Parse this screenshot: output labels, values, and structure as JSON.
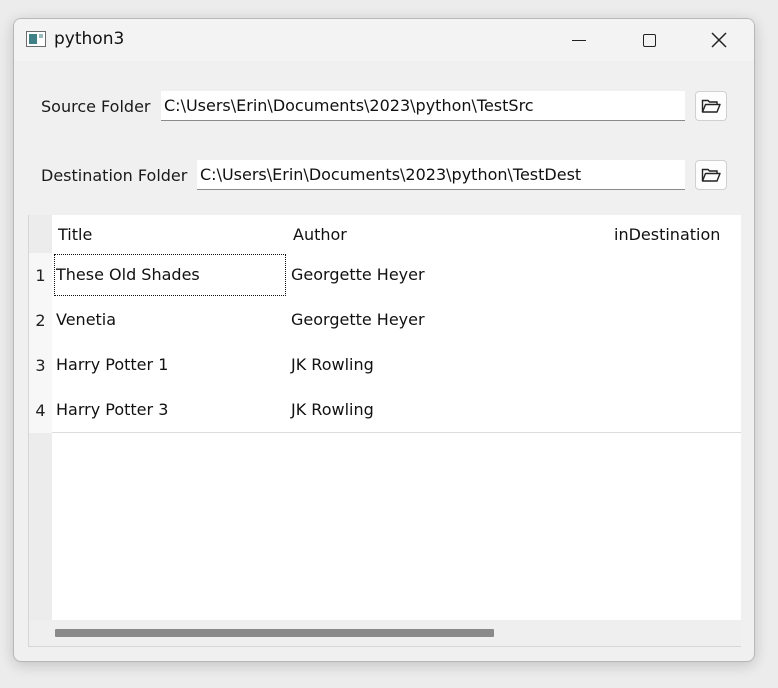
{
  "window": {
    "title": "python3"
  },
  "source": {
    "label": "Source Folder",
    "path": "C:\\Users\\Erin\\Documents\\2023\\python\\TestSrc"
  },
  "destination": {
    "label": "Destination Folder",
    "path": "C:\\Users\\Erin\\Documents\\2023\\python\\TestDest"
  },
  "table": {
    "columns": [
      "Title",
      "Author",
      "inDestination"
    ],
    "rows": [
      {
        "num": "1",
        "title": "These Old Shades",
        "author": "Georgette Heyer",
        "inDestination": ""
      },
      {
        "num": "2",
        "title": "Venetia",
        "author": "Georgette Heyer",
        "inDestination": ""
      },
      {
        "num": "3",
        "title": "Harry Potter 1",
        "author": "JK Rowling",
        "inDestination": ""
      },
      {
        "num": "4",
        "title": "Harry Potter 3",
        "author": "JK Rowling",
        "inDestination": ""
      }
    ]
  },
  "icons": {
    "app": "python-app-icon",
    "minimize": "minimize-icon",
    "maximize": "maximize-icon",
    "close": "close-icon",
    "browse": "folder-open-icon"
  }
}
